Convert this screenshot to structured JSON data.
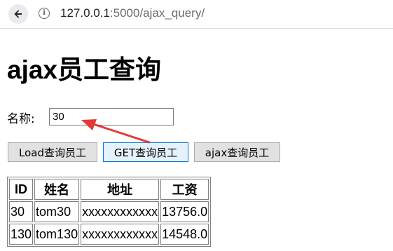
{
  "browser": {
    "url_host": "127.0.0.1",
    "url_rest": ":5000/ajax_query/"
  },
  "page": {
    "title": "ajax员工查询",
    "name_label": "名称:",
    "name_value": "30"
  },
  "buttons": {
    "load": "Load查询员工",
    "get": "GET查询员工",
    "ajax": "ajax查询员工"
  },
  "table": {
    "headers": [
      "ID",
      "姓名",
      "地址",
      "工资"
    ],
    "rows": [
      [
        "30",
        "tom30",
        "xxxxxxxxxxxx",
        "13756.0"
      ],
      [
        "130",
        "tom130",
        "xxxxxxxxxxxx",
        "14548.0"
      ]
    ]
  },
  "colors": {
    "annotation_arrow": "#e53935"
  }
}
